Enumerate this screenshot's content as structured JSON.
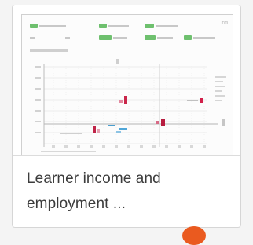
{
  "card": {
    "title": "Learner income and employment ...",
    "thumbnail": {
      "corner_label": "mm",
      "filters": [
        {
          "label": "Learner income"
        },
        {
          "label": "Employment"
        },
        {
          "label": "Sector area"
        },
        {
          "label": "Region"
        }
      ]
    }
  },
  "colors": {
    "chip_green": "#6ec06e",
    "badge_orange": "#ea5a1f",
    "title_text": "#3c3c3c"
  }
}
